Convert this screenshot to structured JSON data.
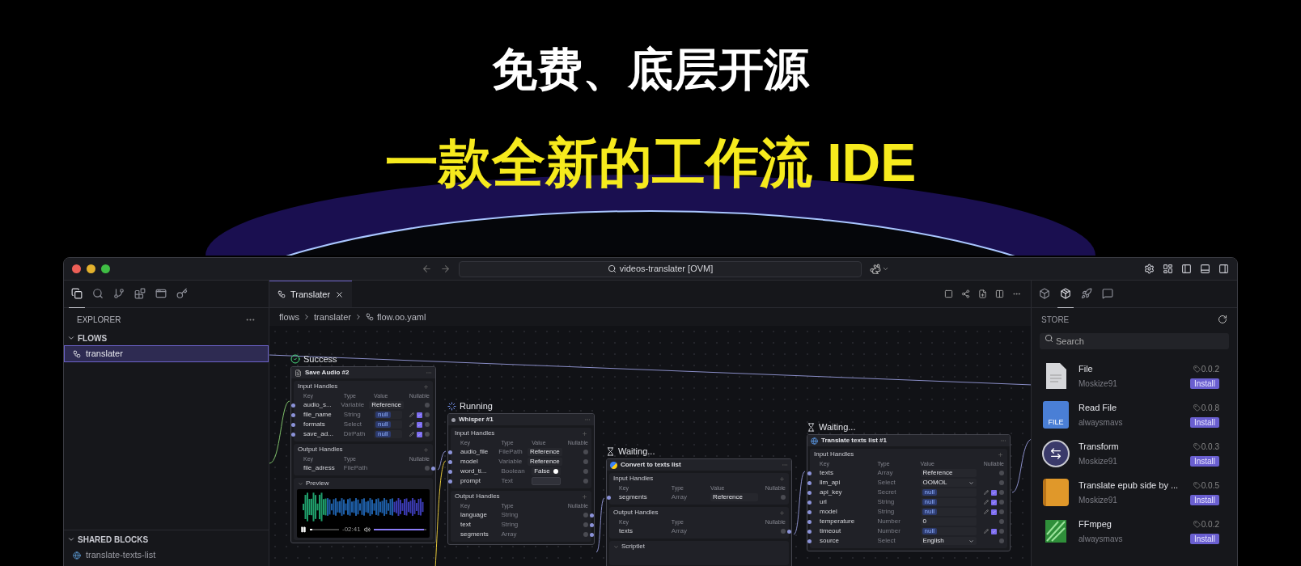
{
  "banner": {
    "title": "免费、底层开源",
    "subtitle": "一款全新的工作流 IDE"
  },
  "window": {
    "address": "videos-translater [OVM]"
  },
  "left_activity": [
    {
      "kind": "files",
      "selected": true
    },
    {
      "kind": "search",
      "selected": false
    },
    {
      "kind": "branch",
      "selected": false
    },
    {
      "kind": "blocks",
      "selected": false
    },
    {
      "kind": "folder",
      "selected": false
    },
    {
      "kind": "key",
      "selected": false
    }
  ],
  "explorer": {
    "title": "EXPLORER",
    "sections": [
      {
        "title": "FLOWS",
        "expanded": true,
        "items": [
          {
            "label": "translater",
            "kind": "flow",
            "selected": true
          }
        ]
      },
      {
        "title": "SHARED BLOCKS",
        "expanded": true,
        "items": [
          {
            "label": "translate-texts-list",
            "kind": "block",
            "selected": false
          }
        ]
      }
    ]
  },
  "tabs": [
    {
      "label": "Translater",
      "selected": true
    }
  ],
  "breadcrumb": [
    "flows",
    "translater",
    "flow.oo.yaml"
  ],
  "nodes": [
    {
      "status": {
        "kind": "success",
        "label": "Success"
      },
      "title": "Save Audio #2",
      "sections": [
        {
          "kind": "inputs",
          "title": "Input Handles",
          "columns": [
            "Key",
            "Type",
            "Value",
            "Nullable"
          ],
          "rows": [
            {
              "key": "audio_s...",
              "type": "Variable",
              "value": "Reference",
              "kind": "text",
              "nullable": false
            },
            {
              "key": "file_name",
              "type": "String",
              "value": "null",
              "kind": "null",
              "nullable": true
            },
            {
              "key": "formats",
              "type": "Select",
              "value": "null",
              "kind": "null",
              "nullable": true
            },
            {
              "key": "save_ad...",
              "type": "DirPath",
              "value": "null",
              "kind": "null",
              "nullable": true
            }
          ]
        },
        {
          "kind": "outputs",
          "title": "Output Handles",
          "columns": [
            "Key",
            "Type",
            "Nullable"
          ],
          "rows": [
            {
              "key": "file_adress",
              "type": "FilePath",
              "nullable": false
            }
          ]
        },
        {
          "kind": "preview",
          "title": "Preview",
          "time": "-02:41",
          "progress": {
            "level": 0.08
          },
          "volume": {
            "level": 0.95
          }
        }
      ]
    },
    {
      "status": {
        "kind": "running",
        "label": "Running"
      },
      "title": "Whisper #1",
      "sections": [
        {
          "kind": "inputs",
          "title": "Input Handles",
          "columns": [
            "Key",
            "Type",
            "Value",
            "Nullable"
          ],
          "rows": [
            {
              "key": "audio_file",
              "type": "FilePath",
              "value": "Reference",
              "kind": "text",
              "nullable": false
            },
            {
              "key": "model",
              "type": "Variable",
              "value": "Reference",
              "kind": "text",
              "nullable": false
            },
            {
              "key": "word_ti...",
              "type": "Boolean",
              "value": "False",
              "kind": "toggle",
              "nullable": false
            },
            {
              "key": "prompt",
              "type": "Text",
              "kind": "textarea",
              "nullable": false
            }
          ]
        },
        {
          "kind": "outputs",
          "title": "Output Handles",
          "columns": [
            "Key",
            "Type",
            "Nullable"
          ],
          "rows": [
            {
              "key": "language",
              "type": "String",
              "nullable": false
            },
            {
              "key": "text",
              "type": "String",
              "nullable": false
            },
            {
              "key": "segments",
              "type": "Array",
              "nullable": false
            }
          ]
        }
      ]
    },
    {
      "status": {
        "kind": "waiting",
        "label": "Waiting..."
      },
      "title": "Convert to texts list",
      "sections": [
        {
          "kind": "inputs",
          "title": "Input Handles",
          "columns": [
            "Key",
            "Type",
            "Value",
            "Nullable"
          ],
          "rows": [
            {
              "key": "segments",
              "type": "Array",
              "value": "Reference",
              "kind": "text",
              "nullable": false
            }
          ]
        },
        {
          "kind": "outputs",
          "title": "Output Handles",
          "columns": [
            "Key",
            "Type",
            "Nullable"
          ],
          "rows": [
            {
              "key": "texts",
              "type": "Array",
              "nullable": false
            }
          ]
        },
        {
          "kind": "scriptlet",
          "title": "Scriptlet"
        }
      ]
    },
    {
      "status": {
        "kind": "waiting",
        "label": "Waiting..."
      },
      "title": "Translate texts list #1",
      "sections": [
        {
          "kind": "inputs",
          "title": "Input Handles",
          "columns": [
            "Key",
            "Type",
            "Value",
            "Nullable"
          ],
          "rows": [
            {
              "key": "texts",
              "type": "Array",
              "value": "Reference",
              "kind": "text",
              "nullable": false
            },
            {
              "key": "llm_api",
              "type": "Select",
              "value": "OOMOL",
              "kind": "select",
              "nullable": false
            },
            {
              "key": "api_key",
              "type": "Secret",
              "value": "null",
              "kind": "null",
              "nullable": true
            },
            {
              "key": "url",
              "type": "String",
              "value": "null",
              "kind": "null",
              "nullable": true
            },
            {
              "key": "model",
              "type": "String",
              "value": "null",
              "kind": "null",
              "nullable": true
            },
            {
              "key": "temperature",
              "type": "Number",
              "value": "0",
              "kind": "text",
              "nullable": false
            },
            {
              "key": "timeout",
              "type": "Number",
              "value": "null",
              "kind": "null",
              "nullable": true
            },
            {
              "key": "source",
              "type": "Select",
              "value": "English",
              "kind": "select",
              "nullable": false
            }
          ]
        }
      ]
    }
  ],
  "right_activity": [
    {
      "kind": "box",
      "selected": false
    },
    {
      "kind": "package",
      "selected": true
    },
    {
      "kind": "rocket",
      "selected": false
    },
    {
      "kind": "message",
      "selected": false
    }
  ],
  "store": {
    "title": "STORE",
    "search": {
      "placeholder": "Search"
    },
    "items": [
      {
        "kind": "file",
        "name": "File",
        "author": "Moskize91",
        "version": "0.0.2",
        "button": "Install"
      },
      {
        "kind": "read-file",
        "name": "Read File",
        "author": "alwaysmavs",
        "version": "0.0.8",
        "button": "Install",
        "icon_text": "FILE"
      },
      {
        "kind": "transform",
        "name": "Transform",
        "author": "Moskize91",
        "version": "0.0.3",
        "button": "Install"
      },
      {
        "kind": "book",
        "name": "Translate epub side by ...",
        "author": "Moskize91",
        "version": "0.0.5",
        "button": "Install"
      },
      {
        "kind": "ffmpeg",
        "name": "FFmpeg",
        "author": "alwaysmavs",
        "version": "0.0.2",
        "button": "Install"
      }
    ]
  }
}
